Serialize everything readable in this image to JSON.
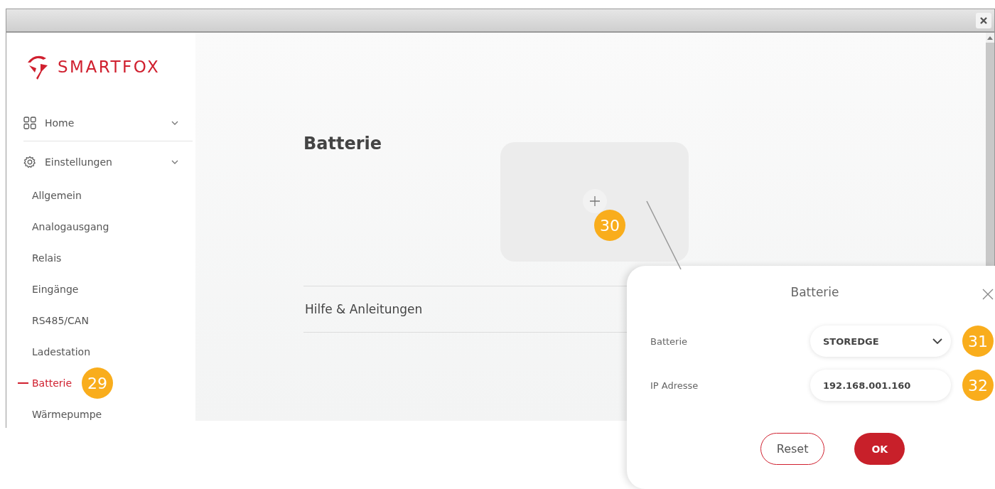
{
  "sidebar": {
    "logo": "SMARTFOX",
    "items": [
      {
        "label": "Home",
        "selected": false
      },
      {
        "label": "Einstellungen",
        "selected": false,
        "children": [
          {
            "label": "Allgemein",
            "selected": false
          },
          {
            "label": "Analogausgang",
            "selected": false
          },
          {
            "label": "Relais",
            "selected": false
          },
          {
            "label": "Eingänge",
            "selected": false
          },
          {
            "label": "RS485/CAN",
            "selected": false
          },
          {
            "label": "Ladestation",
            "selected": false
          },
          {
            "label": "Batterie",
            "selected": true,
            "callout": "29"
          },
          {
            "label": "Wärmepumpe",
            "selected": false
          }
        ]
      }
    ]
  },
  "main": {
    "title": "Batterie",
    "add_card": {
      "callout": "30"
    },
    "help_link": "Hilfe & Anleitungen"
  },
  "dialog": {
    "title": "Batterie",
    "fields": [
      {
        "kind": "select",
        "label": "Batterie",
        "value": "STOREDGE",
        "callout": "31"
      },
      {
        "kind": "input",
        "label": "IP Adresse",
        "value": "192.168.001.160",
        "callout": "32"
      }
    ],
    "buttons": [
      {
        "label": "Reset",
        "kind": "secondary"
      },
      {
        "label": "OK",
        "kind": "primary"
      }
    ]
  }
}
